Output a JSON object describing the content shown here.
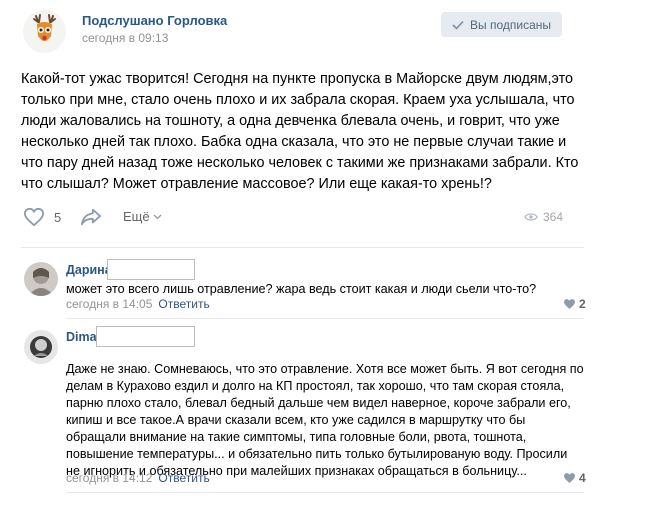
{
  "post": {
    "group_name": "Подслушано Горловка",
    "time": "сегодня в 09:13",
    "subscribed_label": "Вы подписаны",
    "text": "Какой-тот ужас творится! Сегодня на пункте пропуска в Майорске двум людям,это только при мне, стало очень плохо и их забрала скорая. Краем уха услышала, что люди жаловались на тошноту, а одна девченка блевала очень, и говрит, что уже несколько дней так плохо. Бабка одна сказала, что это не первые случаи такие и что пару дней назад тоже несколько человек с такими же признаками забрали. Кто что слышал? Может отравление массовое? Или еще какая-то хрень!?",
    "likes": "5",
    "more_label": "Ещё",
    "views": "364"
  },
  "comments": [
    {
      "author": "Дарина",
      "text": "может это всего лишь отравление? жара ведь стоит какая и люди сьели что-то?",
      "time": "сегодня в 14:05",
      "reply_label": "Ответить",
      "likes": "2"
    },
    {
      "author": "Dima",
      "text": "Даже не знаю. Сомневаюсь, что это отравление. Хотя все может быть. Я вот сегодня по делам в Курахово ездил и долго на КП простоял, так хорошо, что там скорая стояла, парню плохо стало, блевал бедный дальше чем видел наверное, короче забрали его, кипиш и все такое.А врачи сказали всем, кто уже садился в маршрутку что бы обращали внимание на такие симптомы, типа головные боли, рвота, тошнота, повышение температуры... и обязательно пить только бутылированую воду. Просили не игнорить и обязательно при малейших признаках обращаться в больницу...",
      "time": "сегодня в 14:12",
      "reply_label": "Ответить",
      "likes": "4"
    }
  ]
}
